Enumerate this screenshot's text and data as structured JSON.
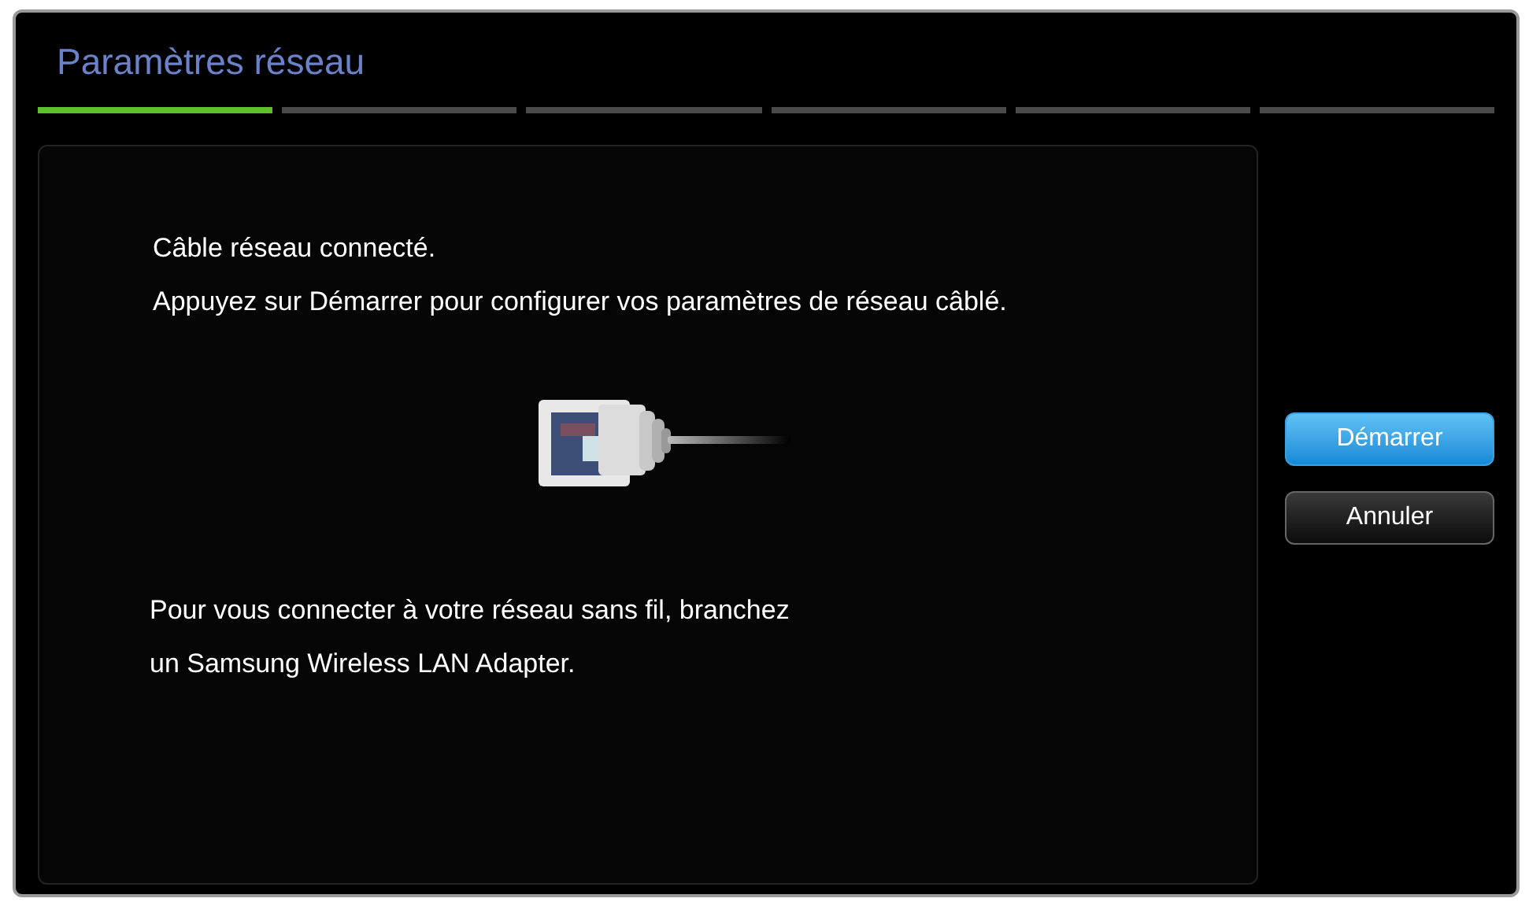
{
  "window": {
    "title": "Paramètres réseau"
  },
  "steps": [
    {
      "active": true
    },
    {
      "active": false
    },
    {
      "active": false
    },
    {
      "active": false
    },
    {
      "active": false
    },
    {
      "active": false
    }
  ],
  "panel": {
    "message_lines": [
      "Câble réseau connecté.",
      "Appuyez sur Démarrer pour configurer vos paramètres de réseau câblé."
    ],
    "footer_lines": [
      "Pour vous connecter à votre réseau sans fil, branchez",
      "un Samsung Wireless LAN Adapter."
    ]
  },
  "buttons": [
    {
      "label": "Démarrer",
      "selected": true
    },
    {
      "label": "Annuler",
      "selected": false
    }
  ]
}
